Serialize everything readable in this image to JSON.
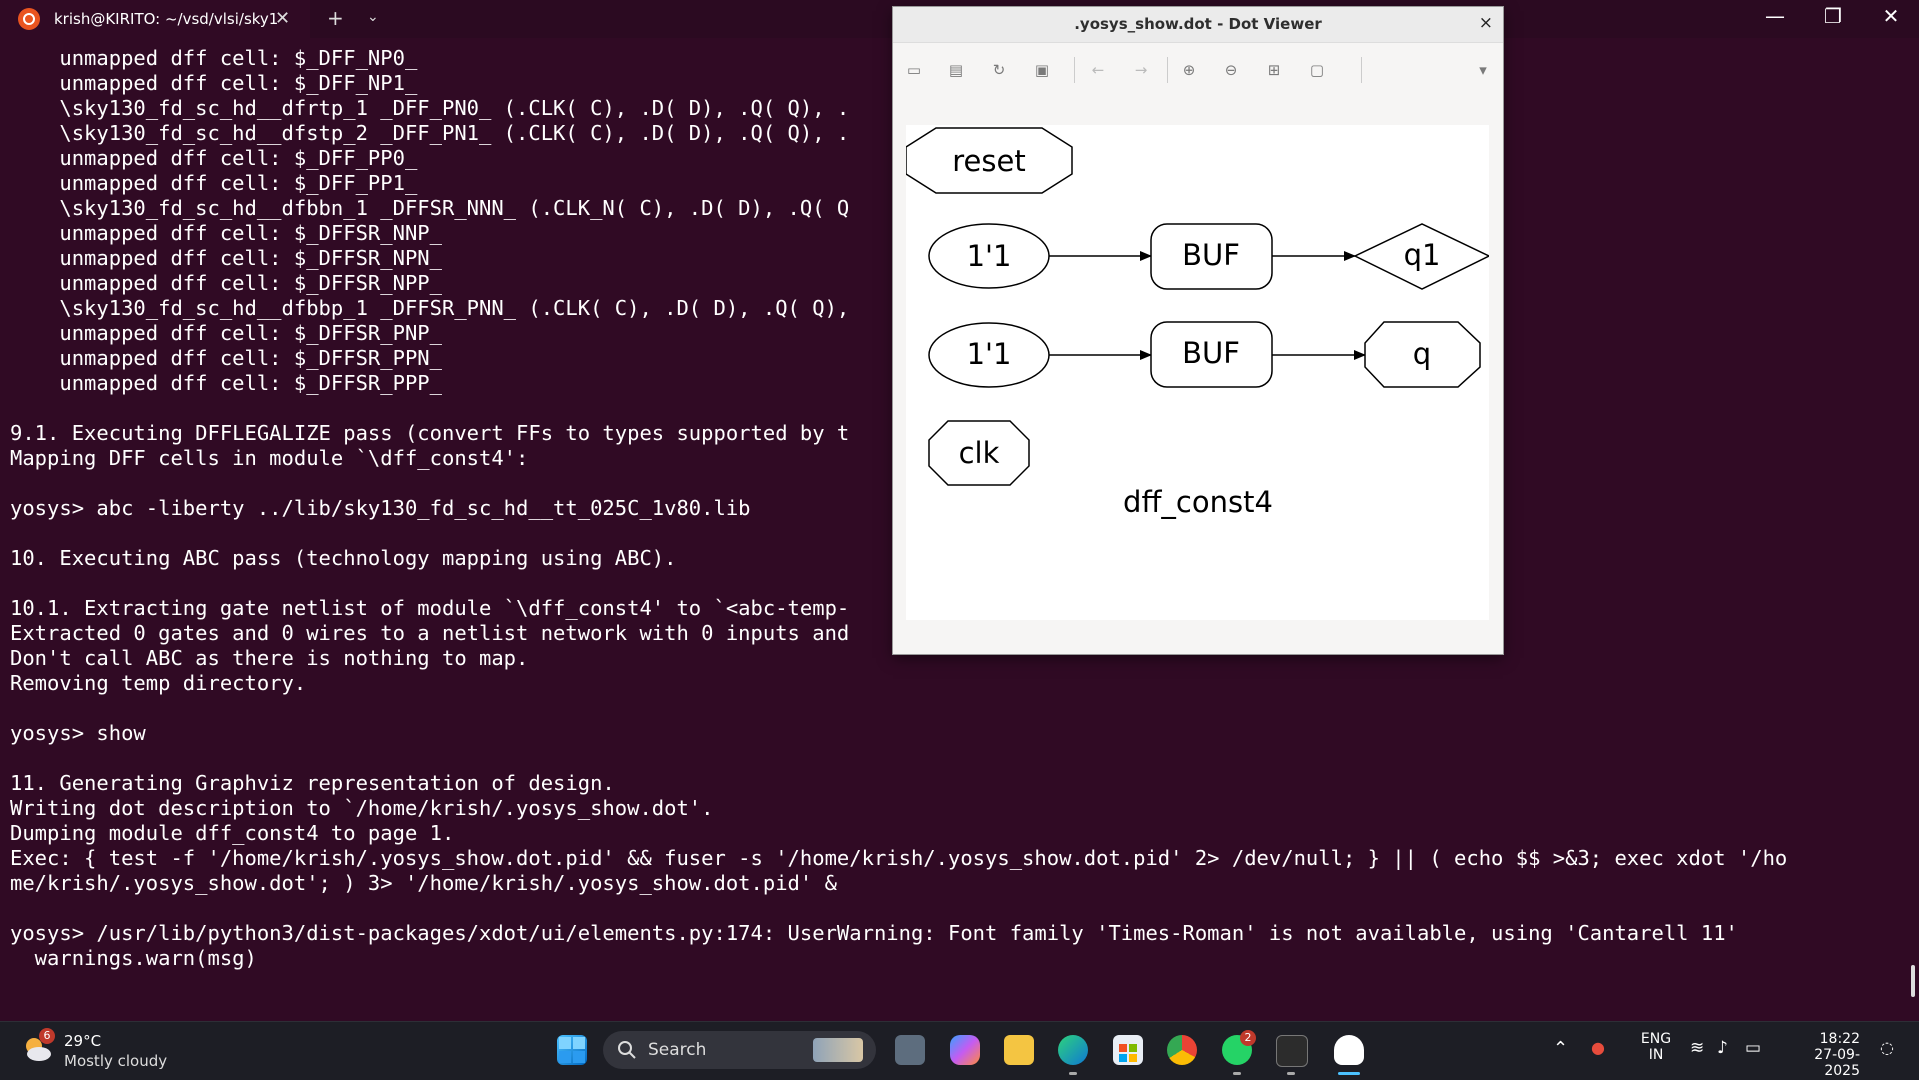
{
  "terminal_tab": {
    "title": "krish@KIRITO: ~/vsd/vlsi/sky1"
  },
  "terminal_lines": [
    "    unmapped dff cell: $_DFF_NP0_",
    "    unmapped dff cell: $_DFF_NP1_",
    "    \\sky130_fd_sc_hd__dfrtp_1 _DFF_PN0_ (.CLK( C), .D( D), .Q( Q), .",
    "    \\sky130_fd_sc_hd__dfstp_2 _DFF_PN1_ (.CLK( C), .D( D), .Q( Q), .",
    "    unmapped dff cell: $_DFF_PP0_",
    "    unmapped dff cell: $_DFF_PP1_",
    "    \\sky130_fd_sc_hd__dfbbn_1 _DFFSR_NNN_ (.CLK_N( C), .D( D), .Q( Q",
    "    unmapped dff cell: $_DFFSR_NNP_",
    "    unmapped dff cell: $_DFFSR_NPN_",
    "    unmapped dff cell: $_DFFSR_NPP_",
    "    \\sky130_fd_sc_hd__dfbbp_1 _DFFSR_PNN_ (.CLK( C), .D( D), .Q( Q),",
    "    unmapped dff cell: $_DFFSR_PNP_",
    "    unmapped dff cell: $_DFFSR_PPN_",
    "    unmapped dff cell: $_DFFSR_PPP_",
    "",
    "9.1. Executing DFFLEGALIZE pass (convert FFs to types supported by t",
    "Mapping DFF cells in module `\\dff_const4':",
    "",
    "yosys> abc -liberty ../lib/sky130_fd_sc_hd__tt_025C_1v80.lib",
    "",
    "10. Executing ABC pass (technology mapping using ABC).",
    "",
    "10.1. Extracting gate netlist of module `\\dff_const4' to `<abc-temp-",
    "Extracted 0 gates and 0 wires to a netlist network with 0 inputs and",
    "Don't call ABC as there is nothing to map.",
    "Removing temp directory.",
    "",
    "yosys> show",
    "",
    "11. Generating Graphviz representation of design.",
    "Writing dot description to `/home/krish/.yosys_show.dot'.",
    "Dumping module dff_const4 to page 1.",
    "Exec: { test -f '/home/krish/.yosys_show.dot.pid' && fuser -s '/home/krish/.yosys_show.dot.pid' 2> /dev/null; } || ( echo $$ >&3; exec xdot '/ho",
    "me/krish/.yosys_show.dot'; ) 3> '/home/krish/.yosys_show.dot.pid' &",
    "",
    "yosys> /usr/lib/python3/dist-packages/xdot/ui/elements.py:174: UserWarning: Font family 'Times-Roman' is not available, using 'Cantarell 11'",
    "  warnings.warn(msg)"
  ],
  "dot_viewer": {
    "title": ".yosys_show.dot - Dot Viewer",
    "close": "×",
    "graph": {
      "nodes": {
        "reset": "reset",
        "const1": "1'1",
        "buf1": "BUF",
        "q1": "q1",
        "const2": "1'1",
        "buf2": "BUF",
        "q": "q",
        "clk": "clk"
      },
      "module_label": "dff_const4"
    }
  },
  "taskbar": {
    "weather": {
      "temp": "29°C",
      "condition": "Mostly cloudy",
      "badge": "6"
    },
    "search_label": "Search",
    "whatsapp_badge": "2",
    "lang_line1": "ENG",
    "lang_line2": "IN",
    "time": "18:22",
    "date": "27-09-2025"
  },
  "colors": {
    "terminal_bg": "#300a24",
    "ubuntu_orange": "#e95420"
  }
}
